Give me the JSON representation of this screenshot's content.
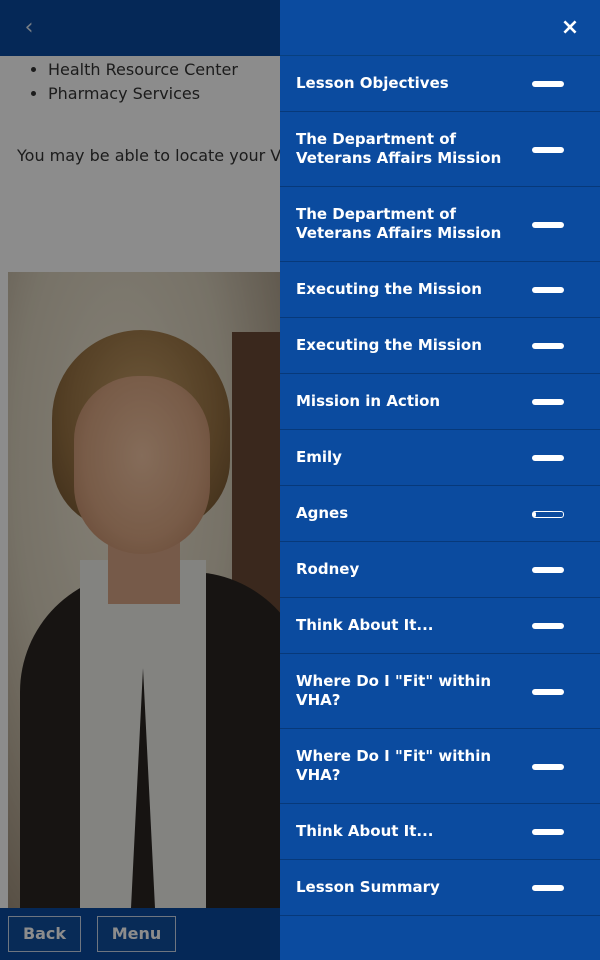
{
  "page": {
    "bullets": [
      "Health Resource Center",
      "Pharmacy Services"
    ],
    "paragraph": "You may be able to locate your VISN"
  },
  "footer": {
    "back_label": "Back",
    "menu_label": "Menu"
  },
  "drawer": {
    "close_label": "×",
    "items": [
      {
        "label": "Lesson Objectives",
        "progress": 1.0
      },
      {
        "label": "The Department of Veterans Affairs Mission",
        "progress": 1.0
      },
      {
        "label": "The Department of Veterans Affairs Mission",
        "progress": 1.0
      },
      {
        "label": "Executing the Mission",
        "progress": 1.0
      },
      {
        "label": "Executing the Mission",
        "progress": 1.0
      },
      {
        "label": "Mission in Action",
        "progress": 1.0
      },
      {
        "label": "Emily",
        "progress": 1.0
      },
      {
        "label": "Agnes",
        "progress": 0.1
      },
      {
        "label": "Rodney",
        "progress": 1.0
      },
      {
        "label": "Think About It...",
        "progress": 1.0
      },
      {
        "label": "Where Do I \"Fit\" within VHA?",
        "progress": 1.0
      },
      {
        "label": "Where Do I \"Fit\" within VHA?",
        "progress": 1.0
      },
      {
        "label": "Think About It...",
        "progress": 1.0
      },
      {
        "label": "Lesson Summary",
        "progress": 1.0
      }
    ]
  },
  "icons": {
    "back": "chevron-left-icon",
    "close": "close-icon"
  },
  "colors": {
    "primary": "#0b4b9f",
    "overlay": "rgba(0,0,0,0.45)",
    "text_on_primary": "#ffffff"
  }
}
